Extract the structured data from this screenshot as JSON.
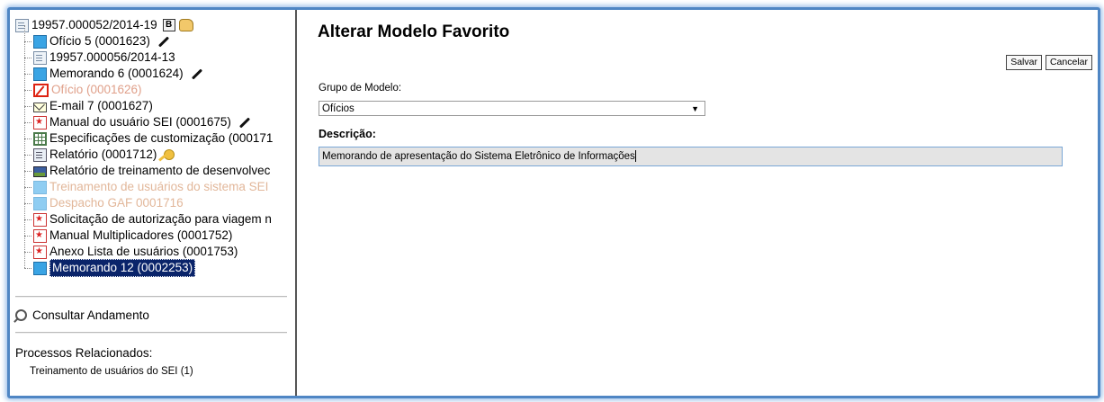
{
  "tree": {
    "root": {
      "label": "19957.000052/2014-19",
      "badge": "B"
    },
    "items": [
      {
        "label": "Ofício 5 (0001623)",
        "icon": "document-icon"
      },
      {
        "label": "19957.000056/2014-13",
        "icon": "process-icon"
      },
      {
        "label": "Memorando 6 (0001624)",
        "icon": "document-icon"
      },
      {
        "label": "Ofício (0001626)",
        "icon": "cancelled-icon"
      },
      {
        "label": "E-mail 7 (0001627)",
        "icon": "email-icon"
      },
      {
        "label": "Manual do usuário SEI (0001675)",
        "icon": "pdf-icon"
      },
      {
        "label": "Especificações de customização (000171",
        "icon": "spreadsheet-icon"
      },
      {
        "label": "Relatório (0001712)",
        "icon": "report-icon"
      },
      {
        "label": "Relatório de treinamento de desenvolvec",
        "icon": "image-icon"
      },
      {
        "label": "Treinamento de usuários do sistema SEI",
        "icon": "document-icon"
      },
      {
        "label": "Despacho GAF 0001716",
        "icon": "document-icon"
      },
      {
        "label": "Solicitação de autorização para viagem n",
        "icon": "pdf-icon"
      },
      {
        "label": "Manual Multiplicadores (0001752)",
        "icon": "pdf-icon"
      },
      {
        "label": "Anexo Lista de usuários (0001753)",
        "icon": "pdf-icon"
      },
      {
        "label": "Memorando 12 (0002253)",
        "icon": "document-icon"
      }
    ]
  },
  "sidebar": {
    "consult_label": "Consultar Andamento",
    "related_title": "Processos Relacionados:",
    "related_item": "Treinamento de usuários do SEI (1)"
  },
  "form": {
    "title": "Alterar Modelo Favorito",
    "save_label": "Salvar",
    "cancel_label": "Cancelar",
    "group_label": "Grupo de Modelo:",
    "group_value": "Ofícios",
    "description_label": "Descrição:",
    "description_value": "Memorando de apresentação do Sistema Eletrônico de Informações"
  },
  "colors": {
    "frame": "#4f86c4",
    "selection": "#0a246a",
    "faded_text": "#e0a08a"
  }
}
